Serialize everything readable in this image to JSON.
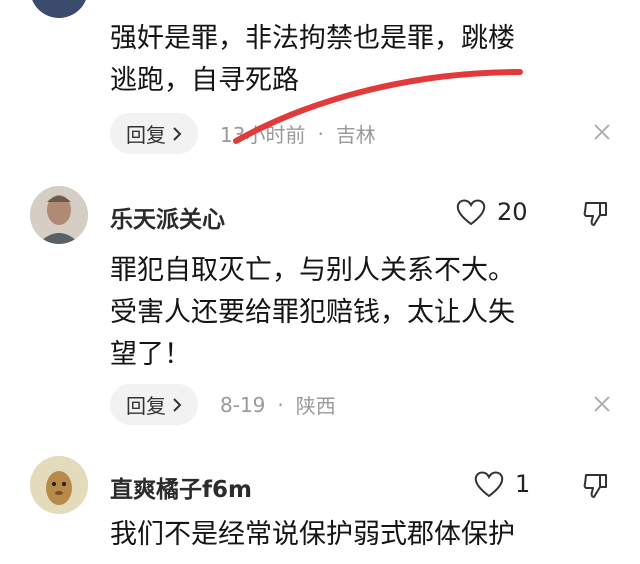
{
  "comment1": {
    "text": "强奸是罪，非法拘禁也是罪，跳楼\n逃跑，自寻死路",
    "reply_label": "回复",
    "time": "13小时前",
    "location": "吉林"
  },
  "comment2": {
    "username": "乐天派关心",
    "likes": "20",
    "text": "罪犯自取灭亡，与别人关系不大。\n受害人还要给罪犯赔钱，太让人失\n望了！",
    "reply_label": "回复",
    "time": "8-19",
    "location": "陕西"
  },
  "comment3": {
    "username": "直爽橘子f6m",
    "likes": "1",
    "text": "我们不是经常说保护弱式郡体保护"
  },
  "colors": {
    "annotation_stroke": "#e23a3a",
    "meta_gray": "#9a9a9a",
    "reply_bg": "#f2f2f2"
  },
  "icons": [
    "heart-outline-icon",
    "thumbs-down-icon",
    "close-icon",
    "chevron-right-icon"
  ]
}
